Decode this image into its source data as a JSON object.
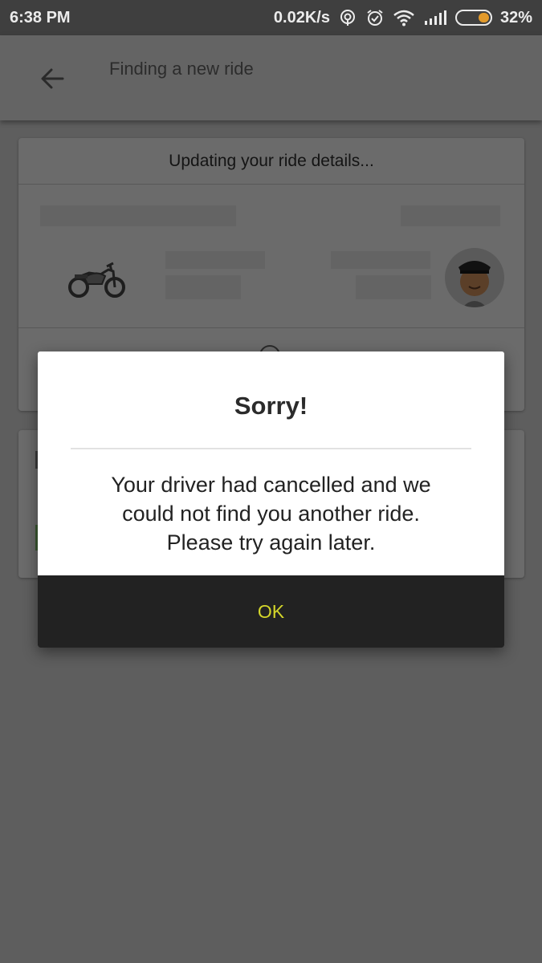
{
  "status_bar": {
    "time": "6:38 PM",
    "net_speed": "0.02K/s",
    "battery_percent": "32%",
    "battery_level": 0.32,
    "icons": [
      "hotspot-icon",
      "alarm-icon",
      "wifi-icon",
      "signal-icon",
      "battery-icon"
    ]
  },
  "app_bar": {
    "title": "Finding a new ride",
    "back_icon": "arrow-left-icon"
  },
  "ride_card": {
    "header": "Updating your ride details...",
    "vehicle_icon": "motorbike-icon",
    "driver_icon": "driver-avatar-icon"
  },
  "dialog": {
    "title": "Sorry!",
    "message_line1": "Your driver had cancelled and we",
    "message_line2": "could not find you another ride.",
    "message_line3": "Please try again later.",
    "ok_label": "OK"
  },
  "colors": {
    "scrim": "#5e5e5e",
    "dialog_bg": "#ffffff",
    "button_bg": "#222222",
    "button_text": "#d4d62a"
  }
}
